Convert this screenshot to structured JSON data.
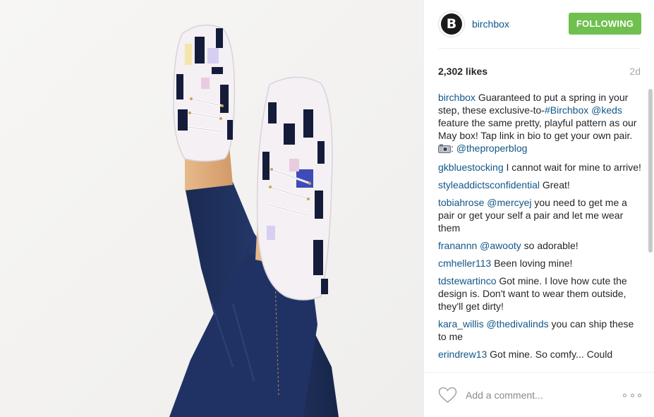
{
  "post": {
    "username": "birchbox",
    "avatar_letter": "B",
    "follow_label": "FOLLOWING",
    "likes": "2,302 likes",
    "time": "2d"
  },
  "caption": {
    "user": "birchbox",
    "text_1": "Guaranteed to put a spring in your step, these exclusive-to-",
    "hashtag": "#Birchbox",
    "mention": "@keds",
    "text_2": "feature the same pretty, playful pattern as our May box! Tap link in bio to get your own pair.",
    "camera_icon": "camera-icon",
    "colon": ":",
    "credit": "@theproperblog"
  },
  "comments": [
    {
      "user": "gkbluestocking",
      "text": "I cannot wait for mine to arrive!"
    },
    {
      "user": "styleaddictsconfidential",
      "text": "Great!"
    },
    {
      "user": "tobiahrose",
      "mention": "@mercyej",
      "text": "you need to get me a pair or get your self a pair and let me wear them"
    },
    {
      "user": "franannn",
      "mention": "@awooty",
      "text": "so adorable!"
    },
    {
      "user": "cmheller113",
      "text": "Been loving mine!"
    },
    {
      "user": "tdstewartinco",
      "text": "Got mine. I love how cute the design is. Don't want to wear them outside, they'll get dirty!"
    },
    {
      "user": "kara_willis",
      "mention": "@thedivalinds",
      "text": "you can ship these to me"
    },
    {
      "user": "erindrew13",
      "text": "Got mine. So comfy... Could"
    }
  ],
  "footer": {
    "comment_placeholder": "Add a comment...",
    "like_icon": "heart-icon",
    "more_icon": "more-options-icon"
  },
  "colors": {
    "link": "#125688",
    "follow_button": "#70c050",
    "muted": "#a5a7aa",
    "denim": "#1e2e57"
  }
}
